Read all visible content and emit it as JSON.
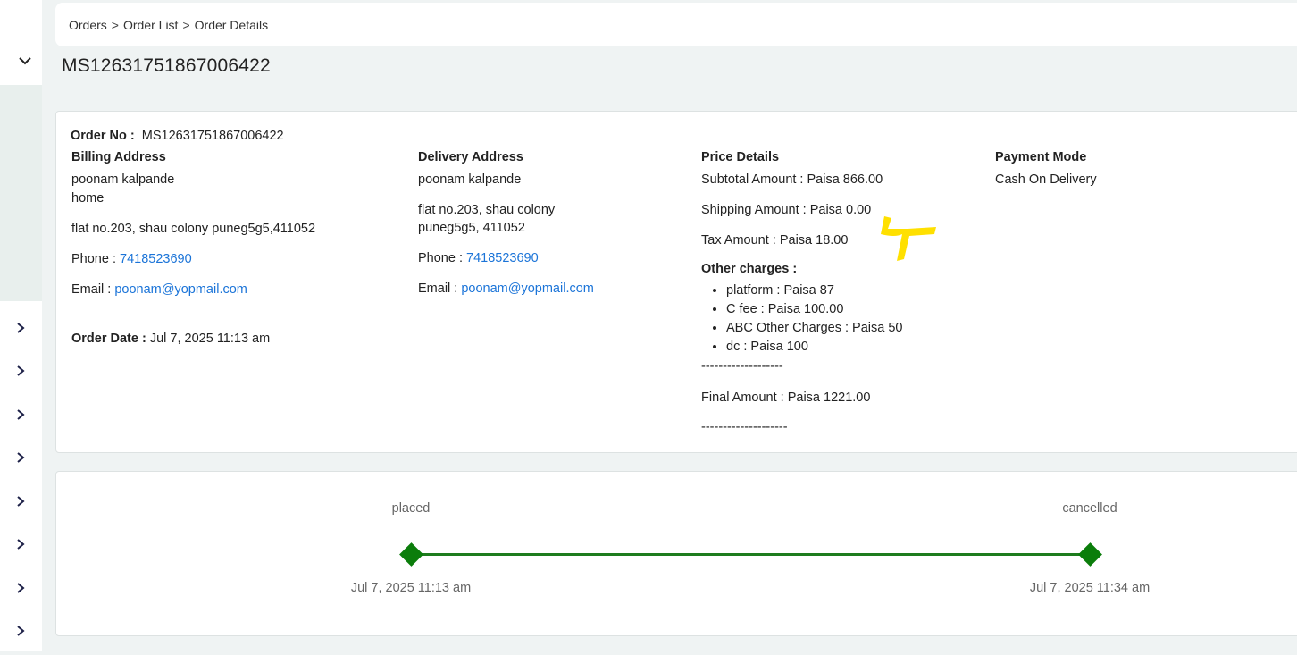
{
  "breadcrumb": {
    "items": [
      "Orders",
      "Order List",
      "Order Details"
    ],
    "separator": ">"
  },
  "page_title": "MS12631751867006422",
  "order": {
    "order_no_label": "Order No :",
    "order_no": "MS12631751867006422",
    "order_date_label": "Order Date :",
    "order_date": "Jul 7, 2025 11:13 am"
  },
  "billing": {
    "heading": "Billing Address",
    "name": "poonam kalpande",
    "tag": "home",
    "address": "flat no.203, shau colony puneg5g5,411052",
    "phone_label": "Phone :",
    "phone": "7418523690",
    "email_label": "Email :",
    "email": "poonam@yopmail.com"
  },
  "delivery": {
    "heading": "Delivery Address",
    "name": "poonam kalpande",
    "address_line1": "flat no.203, shau colony",
    "address_line2": "puneg5g5, 411052",
    "phone_label": "Phone :",
    "phone": "7418523690",
    "email_label": "Email :",
    "email": "poonam@yopmail.com"
  },
  "price": {
    "heading": "Price Details",
    "subtotal": "Subtotal Amount : Paisa 866.00",
    "shipping": "Shipping Amount : Paisa 0.00",
    "tax": "Tax Amount : Paisa  18.00",
    "other_heading": "Other charges :",
    "other_charges": [
      "platform :  Paisa  87",
      "C fee :  Paisa  100.00",
      "ABC Other Charges :  Paisa  50",
      "dc :  Paisa  100"
    ],
    "divider1": "-------------------",
    "final": "Final Amount : Paisa  1221.00",
    "divider2": "--------------------"
  },
  "payment": {
    "heading": "Payment Mode",
    "mode": "Cash On Delivery"
  },
  "timeline": [
    {
      "status": "placed",
      "date": "Jul 7, 2025 11:13 am"
    },
    {
      "status": "cancelled",
      "date": "Jul 7, 2025 11:34 am"
    }
  ],
  "colors": {
    "accent_link": "#1b74d8",
    "timeline_green": "#0b7d0b",
    "annotation_yellow": "#ffe000"
  },
  "icons": {
    "sidebar_top": "chevron-down-icon",
    "sidebar_items": "chevron-right-icon"
  }
}
